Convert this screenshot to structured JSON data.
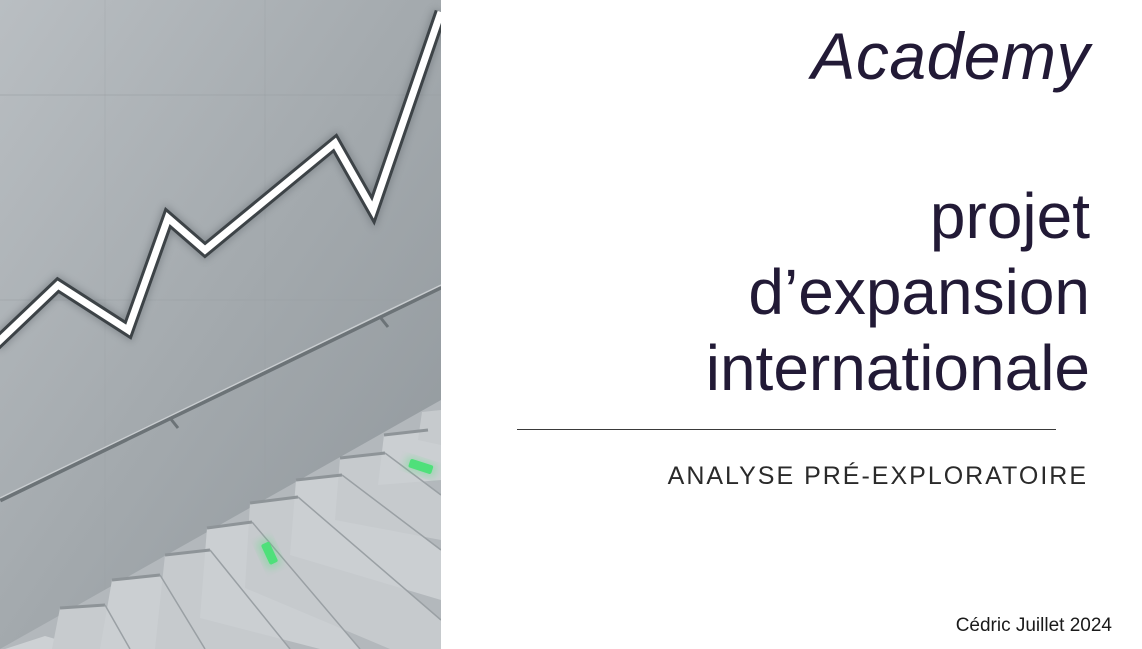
{
  "slide": {
    "brand": "Academy",
    "title_lines": [
      "projet",
      "d’expansion",
      "internationale"
    ],
    "subtitle": "ANALYSE PRÉ-EXPLORATOIRE",
    "author_line": "Cédric Juillet 2024"
  },
  "image": {
    "subject": "concrete-wall-staircase-growth-arrow",
    "colors": {
      "wall": "#a7adb1",
      "stairs": "#c6cacd",
      "neon": "#ffffff",
      "step_light": "#4fe07a"
    }
  },
  "colors": {
    "title_text": "#221a36",
    "subtitle_text": "#2a2a2a",
    "background": "#ffffff"
  }
}
